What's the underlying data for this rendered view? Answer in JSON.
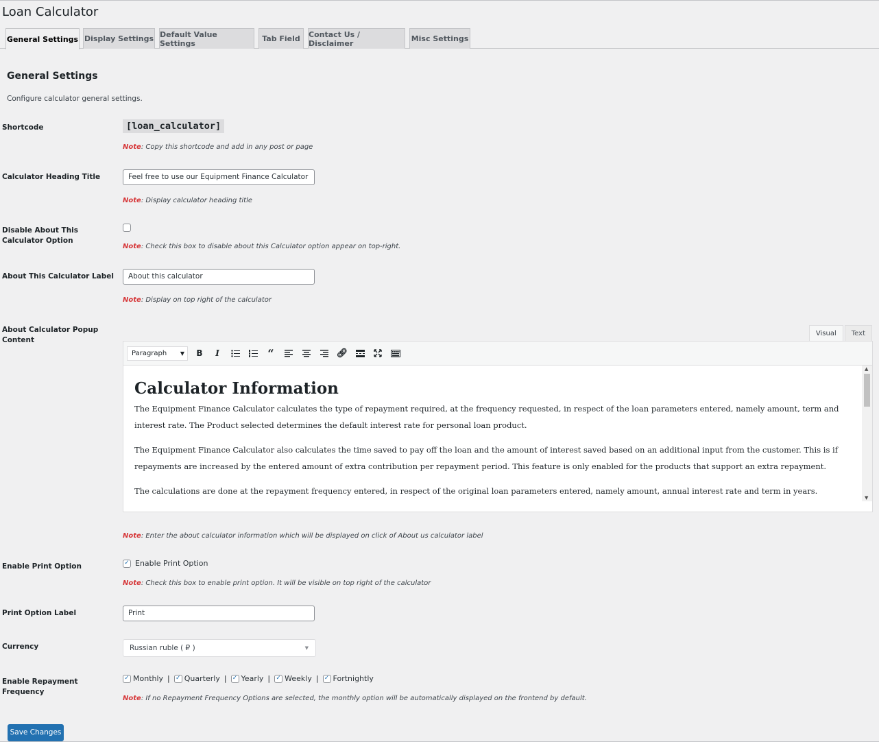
{
  "page_title": "Loan Calculator",
  "tabs": [
    {
      "label": "General Settings",
      "active": true
    },
    {
      "label": "Display Settings"
    },
    {
      "label": "Default Value Settings"
    },
    {
      "label": "Tab Field"
    },
    {
      "label": "Contact Us / Disclaimer"
    },
    {
      "label": "Misc Settings"
    }
  ],
  "section": {
    "title": "General Settings",
    "description": "Configure calculator general settings."
  },
  "note_prefix": "Note",
  "fields": {
    "shortcode": {
      "label": "Shortcode",
      "value": "[loan_calculator]",
      "note": ": Copy this shortcode and add in any post or page"
    },
    "heading_title": {
      "label": "Calculator Heading Title",
      "value": "Feel free to use our Equipment Finance Calculator",
      "note": ": Display calculator heading title"
    },
    "disable_about": {
      "label": "Disable About This Calculator Option",
      "checked": false,
      "note": ": Check this box to disable about this Calculator option appear on top-right."
    },
    "about_label": {
      "label": "About This Calculator Label",
      "value": "About this calculator",
      "note": ": Display on top right of the calculator"
    },
    "about_popup": {
      "label": "About Calculator Popup Content",
      "editor_tabs": [
        "Visual",
        "Text"
      ],
      "format_select": "Paragraph",
      "toolbar_icons": [
        "bold-icon",
        "italic-icon",
        "bullet-list-icon",
        "numbered-list-icon",
        "blockquote-icon",
        "align-left-icon",
        "align-center-icon",
        "align-right-icon",
        "link-icon",
        "read-more-icon",
        "fullscreen-icon",
        "toolbar-toggle-icon"
      ],
      "content_heading": "Calculator Information",
      "paragraphs": [
        "The Equipment Finance Calculator calculates the type of repayment required, at the frequency requested, in respect of the loan parameters entered, namely amount, term and interest rate. The Product selected determines the default interest rate for personal loan product.",
        "The Equipment Finance Calculator also calculates the time saved to pay off the loan and the amount of interest saved based on an additional input from the customer. This is if repayments are increased by the entered amount of extra contribution per repayment period. This feature is only enabled for the products that support an extra repayment.",
        "The calculations are done at the repayment frequency entered, in respect of the original loan parameters entered, namely amount, annual interest rate and term in years."
      ],
      "note": ": Enter the about calculator information which will be displayed on click of About us calculator label"
    },
    "enable_print": {
      "label": "Enable Print Option",
      "checkbox_label": "Enable Print Option",
      "checked": true,
      "note": ": Check this box to enable print option. It will be visible on top right of the calculator"
    },
    "print_label": {
      "label": "Print Option Label",
      "value": "Print"
    },
    "currency": {
      "label": "Currency",
      "value": "Russian ruble ( ₽ )"
    },
    "repayment_frequency": {
      "label": "Enable Repayment Frequency",
      "options": [
        {
          "label": "Monthly",
          "checked": true
        },
        {
          "label": "Quarterly",
          "checked": true
        },
        {
          "label": "Yearly",
          "checked": true
        },
        {
          "label": "Weekly",
          "checked": true
        },
        {
          "label": "Fortnightly",
          "checked": true
        }
      ],
      "note": ": If no Repayment Frequency Options are selected, the monthly option will be automatically displayed on the frontend by default."
    }
  },
  "save_button": "Save Changes",
  "colors": {
    "accent": "#2271b1",
    "note_red": "#d63638",
    "background": "#f0f0f1"
  }
}
